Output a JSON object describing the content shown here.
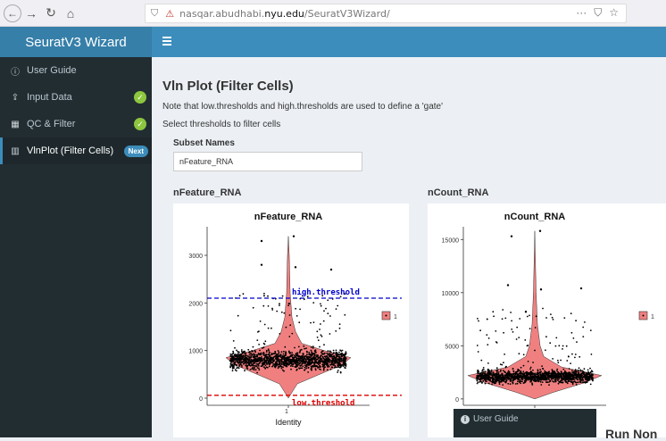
{
  "browser": {
    "url_domain_prefix": "nasqar.abudhabi.",
    "url_domain_bold": "nyu.edu",
    "url_path": "/SeuratV3Wizard/",
    "more": "···"
  },
  "app": {
    "title": "SeuratV3 Wizard"
  },
  "sidebar": {
    "items": [
      {
        "label": "User Guide",
        "icon": "info-icon"
      },
      {
        "label": "Input Data",
        "icon": "upload-icon",
        "check": "✓"
      },
      {
        "label": "QC & Filter",
        "icon": "grid-icon",
        "check": "✓"
      },
      {
        "label": "VlnPlot (Filter Cells)",
        "icon": "chart-icon",
        "badge": "Next"
      }
    ]
  },
  "main": {
    "title": "Vln Plot (Filter Cells)",
    "note": "Note that low.thresholds and high.thresholds are used to define a 'gate'",
    "instruction": "Select thresholds to filter cells",
    "subset_label": "Subset Names",
    "subset_value": "nFeature_RNA",
    "plot1_title": "nFeature_RNA",
    "plot2_title": "nCount_RNA"
  },
  "overlay": {
    "sidebar_item": "User Guide",
    "title": "Run Non"
  },
  "chart_data": [
    {
      "type": "violin",
      "title": "nFeature_RNA",
      "xlabel": "Identity",
      "ylabel": "",
      "categories": [
        "1"
      ],
      "yticks": [
        0,
        1000,
        2000,
        3000
      ],
      "ylim": [
        -150,
        3600
      ],
      "legend": [
        "1"
      ],
      "legend_position": "right",
      "annotations": [
        {
          "label": "high.threshold",
          "y": 2100,
          "color": "#0000cc"
        },
        {
          "label": "low.threshold",
          "y": 60,
          "color": "#dd0000"
        }
      ],
      "fill_color": "#f08080"
    },
    {
      "type": "violin",
      "title": "nCount_RNA",
      "xlabel": "",
      "ylabel": "",
      "categories": [
        "1"
      ],
      "yticks": [
        0,
        5000,
        10000,
        15000
      ],
      "ylim": [
        -600,
        16200
      ],
      "legend": [
        "1"
      ],
      "legend_position": "right",
      "fill_color": "#f08080"
    }
  ]
}
